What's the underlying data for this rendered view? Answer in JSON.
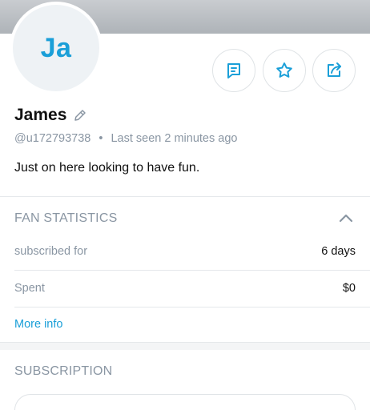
{
  "profile": {
    "avatar_initials": "Ja",
    "name": "James",
    "handle": "@u172793738",
    "separator": "•",
    "last_seen": "Last seen 2 minutes ago",
    "bio": "Just on here looking to have fun."
  },
  "actions": {
    "message_icon": "message-icon",
    "favorite_icon": "star-icon",
    "share_icon": "share-icon"
  },
  "fan_statistics": {
    "title": "FAN STATISTICS",
    "rows": [
      {
        "label": "subscribed for",
        "value": "6 days"
      },
      {
        "label": "Spent",
        "value": "$0"
      }
    ],
    "more_info": "More info"
  },
  "subscription": {
    "title": "SUBSCRIPTION"
  },
  "colors": {
    "accent": "#1a9fd8",
    "muted": "#8a96a3",
    "border": "#e5e8eb"
  }
}
